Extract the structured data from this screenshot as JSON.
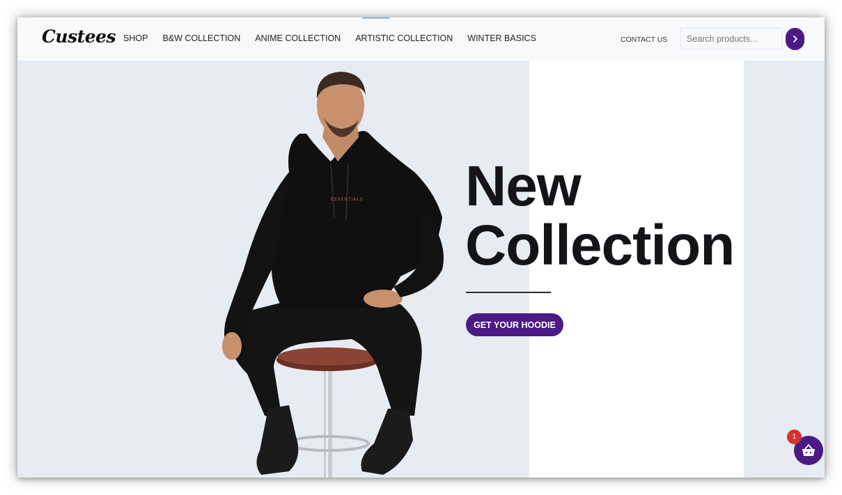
{
  "header": {
    "logo_text": "Custees",
    "nav": [
      {
        "label": "SHOP"
      },
      {
        "label": "B&W COLLECTION"
      },
      {
        "label": "ANIME COLLECTION"
      },
      {
        "label": "ARTISTIC COLLECTION"
      },
      {
        "label": "WINTER BASICS"
      }
    ],
    "contact_label": "CONTACT US",
    "search": {
      "placeholder": "Search products...",
      "button_icon": "chevron-right-icon"
    }
  },
  "hero": {
    "headline_line1": "New",
    "headline_line2": "Collection",
    "cta_label": "GET YOUR HOODIE",
    "image": "model-in-black-hoodie-on-stool"
  },
  "cart": {
    "icon": "basket-icon",
    "count": "1"
  },
  "colors": {
    "accent": "#4b1a83",
    "badge": "#d6322f",
    "hero_bg": "#e7ebf2",
    "header_bg": "#f7f9fb",
    "headline": "#141418"
  }
}
